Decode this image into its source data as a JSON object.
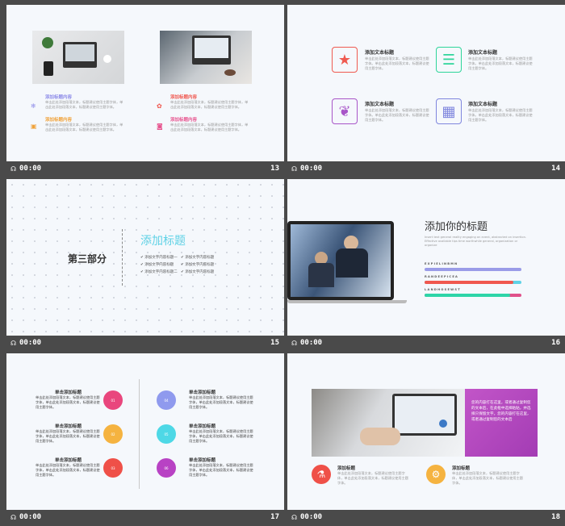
{
  "footer": {
    "time": "00:00",
    "play_glyph": "☊"
  },
  "slides": [
    {
      "number": "13",
      "items": [
        {
          "title": "添加标题内容",
          "color": "#8d8be8",
          "text": "单击此处添加段落文本，标题建议使用主题字体，单击此处添加段落文本，标题建议使用主题字体。"
        },
        {
          "title": "添加标题内容",
          "color": "#f0a23a",
          "text": "单击此处添加段落文本，标题建议使用主题字体，单击此处添加段落文本，标题建议使用主题字体。"
        },
        {
          "title": "添加标题内容",
          "color": "#f0584f",
          "text": "单击此处添加段落文本，标题建议使用主题字体，单击此处添加段落文本，标题建议使用主题字体。"
        },
        {
          "title": "添加标题内容",
          "color": "#e7558f",
          "text": "单击此处添加段落文本，标题建议使用主题字体，单击此处添加段落文本，标题建议使用主题字体。"
        }
      ]
    },
    {
      "number": "14",
      "items": [
        {
          "title": "添加文本标题",
          "text": "单击此处添加段落文本，标题建议使用主题字体。单击此处添加段落文本，标题建议使用主题字体。",
          "color": "#ef5a50",
          "icon": "star-icon"
        },
        {
          "title": "添加文本标题",
          "text": "单击此处添加段落文本，标题建议使用主题字体。单击此处添加段落文本，标题建议使用主题字体。",
          "color": "#2ed59a",
          "icon": "menu-icon"
        },
        {
          "title": "添加文本标题",
          "text": "单击此处添加段落文本，标题建议使用主题字体。单击此处添加段落文本，标题建议使用主题字体。",
          "color": "#a855c8",
          "icon": "leaf-icon"
        },
        {
          "title": "添加文本标题",
          "text": "单击此处添加段落文本，标题建议使用主题字体。单击此处添加段落文本，标题建议使用主题字体。",
          "color": "#7f86de",
          "icon": "calendar-icon"
        }
      ]
    },
    {
      "number": "15",
      "section": "第三部分",
      "title": "添加标题",
      "checks": [
        "添加文字内容标题一",
        "添加文字内容标题",
        "添加文字内容标题二",
        "添加文字内容标题",
        "添加文字内容标题",
        "添加文字内容标题"
      ]
    },
    {
      "number": "16",
      "title": "添加你的标题",
      "subtitle": "Insert text general reality engaging an event, abstracted on insertion. Effective available tips time worthwhile general, organization or organize",
      "bars": [
        {
          "label": "E X P I E L I N B M N",
          "percent": 100,
          "color": "#9a9ce8"
        },
        {
          "label": "R A N D E E P I C E A",
          "percent": 92,
          "color": "#f0584f"
        },
        {
          "label": "L A N D H O S E W S T",
          "percent": 88,
          "color": "#2ed5a8"
        }
      ]
    },
    {
      "number": "17",
      "items": [
        {
          "title": "单击添加标题",
          "text": "单击此处添加段落文本，标题建议使用主题字体，单击此处添加段落文本，标题建议使用主题字体。",
          "color": "#e9467d",
          "label": "01"
        },
        {
          "title": "单击添加标题",
          "text": "单击此处添加段落文本，标题建议使用主题字体，单击此处添加段落文本，标题建议使用主题字体。",
          "color": "#f5b340",
          "label": "02"
        },
        {
          "title": "单击添加标题",
          "text": "单击此处添加段落文本，标题建议使用主题字体，单击此处添加段落文本，标题建议使用主题字体。",
          "color": "#ef5048",
          "label": "03"
        },
        {
          "title": "单击添加标题",
          "text": "单击此处添加段落文本，标题建议使用主题字体，单击此处添加段落文本，标题建议使用主题字体。",
          "color": "#8f9aee",
          "label": "04"
        },
        {
          "title": "单击添加标题",
          "text": "单击此处添加段落文本，标题建议使用主题字体，单击此处添加段落文本，标题建议使用主题字体。",
          "color": "#4ed8e6",
          "label": "05"
        },
        {
          "title": "单击添加标题",
          "text": "单击此处添加段落文本，标题建议使用主题字体，单击此处添加段落文本，标题建议使用主题字体。",
          "color": "#b842c4",
          "label": "06"
        }
      ]
    },
    {
      "number": "18",
      "overlay_text": "您的内容打在这里，或者通过复制您的文本后，在此框中选择粘贴，并选择只保留文字。您的内容打在这里，或者通过复制您的文本后",
      "items": [
        {
          "title": "添加标题",
          "text": "单击此处添加段落文本，标题建议使用主题字体，单击此处添加段落文本，标题建议使用主题字体。",
          "color": "#ef5048",
          "icon": "flask-icon"
        },
        {
          "title": "添加标题",
          "text": "单击此处添加段落文本，标题建议使用主题字体，单击此处添加段落文本，标题建议使用主题字体。",
          "color": "#f5b340",
          "icon": "chart-icon"
        }
      ]
    }
  ]
}
